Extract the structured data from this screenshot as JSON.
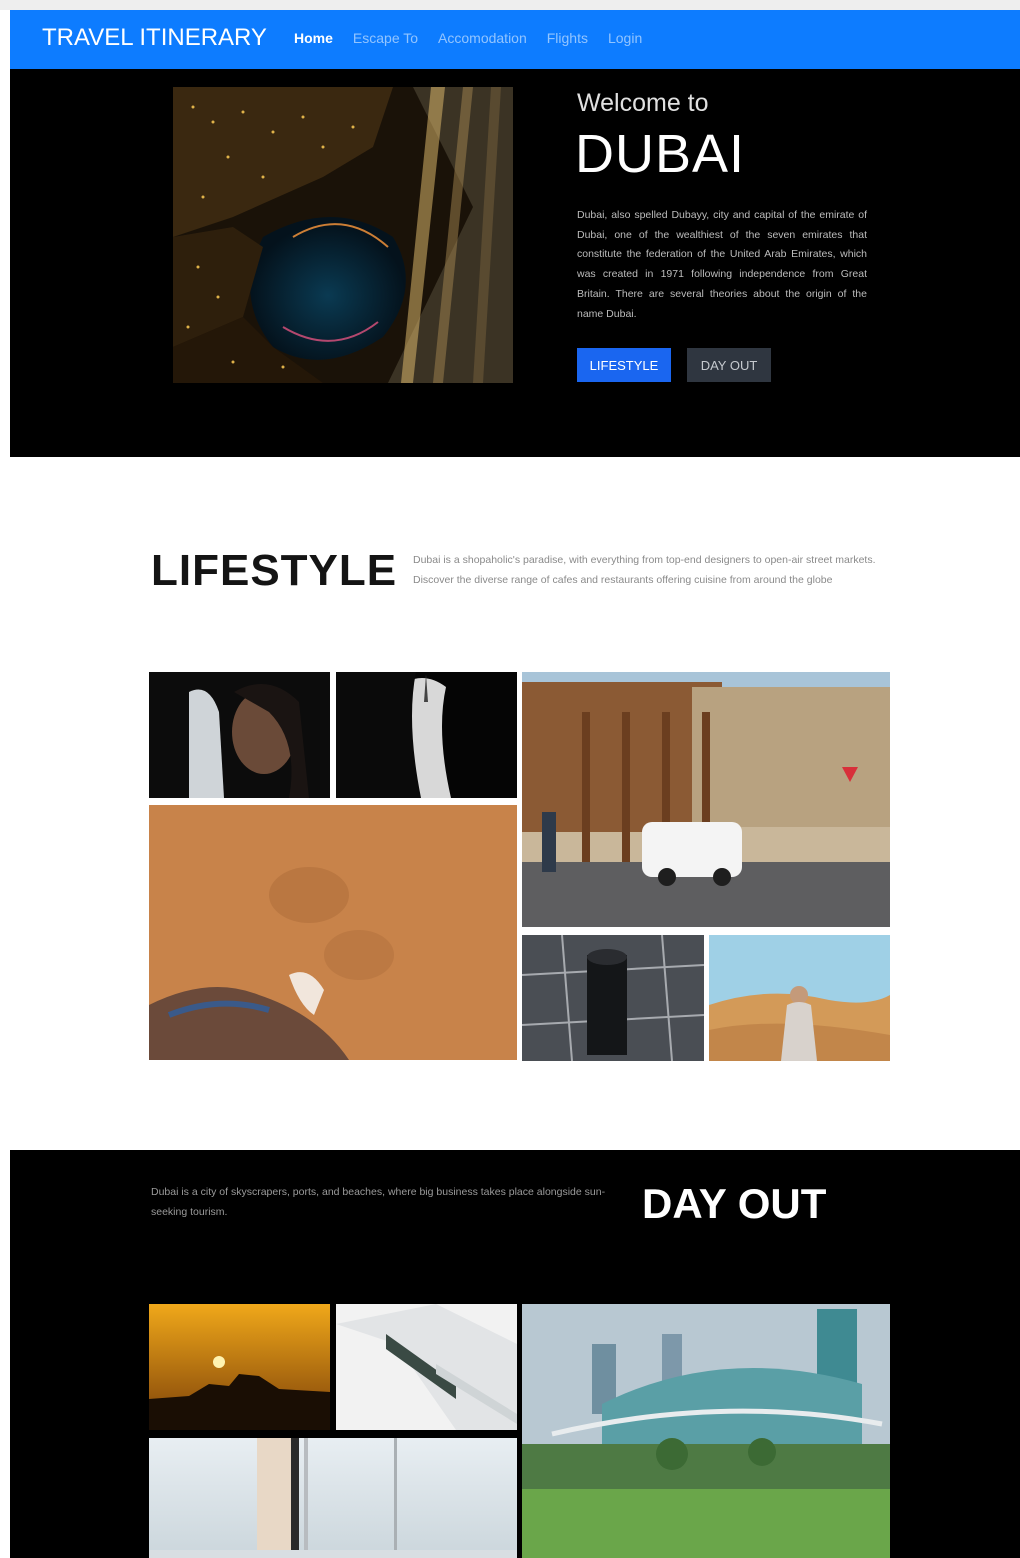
{
  "navbar": {
    "brand": "TRAVEL ITINERARY",
    "links": [
      {
        "label": "Home",
        "active": true
      },
      {
        "label": "Escape To",
        "active": false
      },
      {
        "label": "Accomodation",
        "active": false
      },
      {
        "label": "Flights",
        "active": false
      },
      {
        "label": "Login",
        "active": false
      }
    ]
  },
  "hero": {
    "welcome": "Welcome to",
    "title": "DUBAI",
    "description": "Dubai, also spelled Dubayy, city and capital of the emirate of Dubai, one of the wealthiest of the seven emirates that constitute the federation of the United Arab Emirates, which was created in 1971 following independence from Great Britain. There are several theories about the origin of the name Dubai.",
    "buttons": {
      "lifestyle": "LIFESTYLE",
      "dayout": "DAY OUT"
    }
  },
  "lifestyle": {
    "title": "LIFESTYLE",
    "description": "Dubai is a shopaholic's paradise, with everything from top-end designers to open-air street markets. Discover the diverse range of cafes and restaurants offering cuisine from around the globe"
  },
  "dayout": {
    "title": "DAY OUT",
    "description": "Dubai is a city of skyscrapers, ports, and beaches, where big business takes place alongside sun-seeking tourism."
  },
  "colors": {
    "navbar": "#0d7cff",
    "primary_button": "#1a66f0",
    "secondary_button": "#2f3640",
    "dark_section": "#000000"
  }
}
